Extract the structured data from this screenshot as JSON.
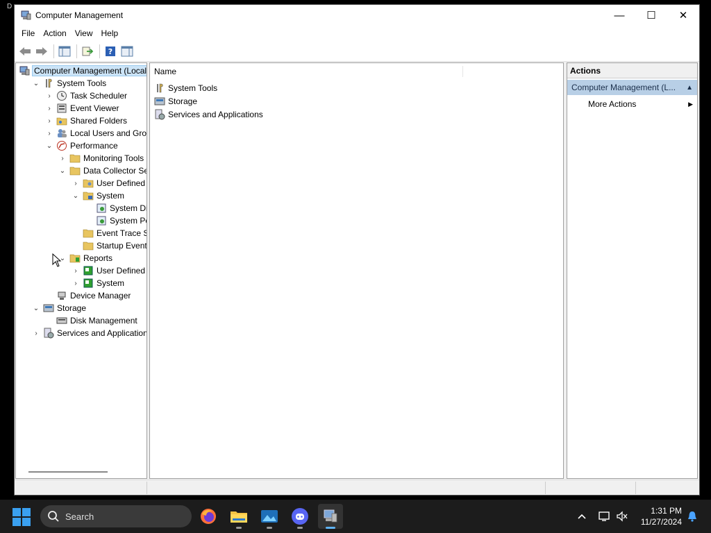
{
  "window": {
    "title": "Computer Management",
    "controls": {
      "minimize": "—",
      "maximize": "☐",
      "close": "✕"
    }
  },
  "menu": [
    "File",
    "Action",
    "View",
    "Help"
  ],
  "tree": [
    {
      "label": "Computer Management (Local",
      "indent": 0,
      "chevron": "",
      "icon": "computer-management-icon",
      "selected": true
    },
    {
      "label": "System Tools",
      "indent": 1,
      "chevron": "⌄",
      "icon": "system-tools-icon"
    },
    {
      "label": "Task Scheduler",
      "indent": 2,
      "chevron": "›",
      "icon": "clock-icon"
    },
    {
      "label": "Event Viewer",
      "indent": 2,
      "chevron": "›",
      "icon": "event-viewer-icon"
    },
    {
      "label": "Shared Folders",
      "indent": 2,
      "chevron": "›",
      "icon": "shared-folders-icon"
    },
    {
      "label": "Local Users and Groups",
      "indent": 2,
      "chevron": "›",
      "icon": "users-icon"
    },
    {
      "label": "Performance",
      "indent": 2,
      "chevron": "⌄",
      "icon": "performance-icon"
    },
    {
      "label": "Monitoring Tools",
      "indent": 3,
      "chevron": "›",
      "icon": "folder-icon"
    },
    {
      "label": "Data Collector Sets",
      "indent": 3,
      "chevron": "⌄",
      "icon": "folder-icon"
    },
    {
      "label": "User Defined",
      "indent": 4,
      "chevron": "›",
      "icon": "folder-user-icon"
    },
    {
      "label": "System",
      "indent": 4,
      "chevron": "⌄",
      "icon": "folder-system-icon"
    },
    {
      "label": "System Diagr",
      "indent": 5,
      "chevron": "",
      "icon": "diagnostics-icon"
    },
    {
      "label": "System Perfo",
      "indent": 5,
      "chevron": "",
      "icon": "diagnostics-icon"
    },
    {
      "label": "Event Trace Sess",
      "indent": 4,
      "chevron": "",
      "icon": "folder-icon"
    },
    {
      "label": "Startup Event Tra",
      "indent": 4,
      "chevron": "",
      "icon": "folder-icon"
    },
    {
      "label": "Reports",
      "indent": 3,
      "chevron": "⌄",
      "icon": "reports-icon"
    },
    {
      "label": "User Defined",
      "indent": 4,
      "chevron": "›",
      "icon": "report-green-icon"
    },
    {
      "label": "System",
      "indent": 4,
      "chevron": "›",
      "icon": "report-green-icon"
    },
    {
      "label": "Device Manager",
      "indent": 2,
      "chevron": "",
      "icon": "device-manager-icon"
    },
    {
      "label": "Storage",
      "indent": 1,
      "chevron": "⌄",
      "icon": "storage-icon"
    },
    {
      "label": "Disk Management",
      "indent": 2,
      "chevron": "",
      "icon": "disk-icon"
    },
    {
      "label": "Services and Applications",
      "indent": 1,
      "chevron": "›",
      "icon": "services-icon"
    }
  ],
  "list": {
    "column": "Name",
    "items": [
      {
        "label": "System Tools",
        "icon": "system-tools-icon"
      },
      {
        "label": "Storage",
        "icon": "storage-icon"
      },
      {
        "label": "Services and Applications",
        "icon": "services-icon"
      }
    ]
  },
  "actions": {
    "header": "Actions",
    "section": "Computer Management (L...",
    "section_arrow": "▲",
    "items": [
      {
        "label": "More Actions",
        "arrow": "▶"
      }
    ]
  },
  "taskbar": {
    "search_placeholder": "Search",
    "time": "1:31 PM",
    "date": "11/27/2024"
  },
  "desktop_label": "D",
  "colors": {
    "accent": "#3aa0f0",
    "selection": "#cce4f7",
    "actions_section": "#b8cfe6"
  }
}
